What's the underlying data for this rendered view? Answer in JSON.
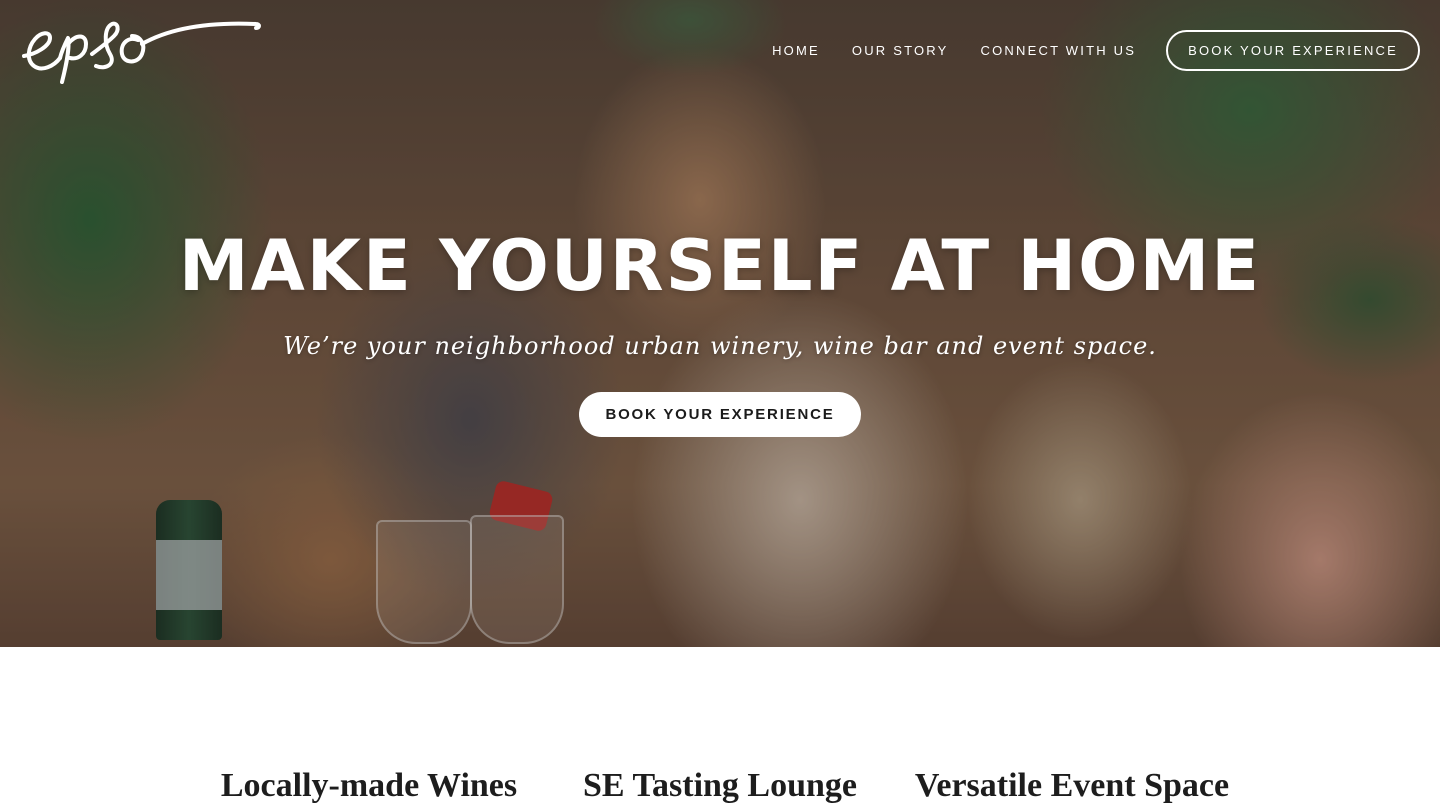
{
  "brand": {
    "logo_text": "enso"
  },
  "nav": {
    "items": [
      {
        "label": "HOME"
      },
      {
        "label": "OUR STORY"
      },
      {
        "label": "CONNECT WITH US"
      }
    ],
    "cta_label": "BOOK YOUR EXPERIENCE"
  },
  "hero": {
    "title": "MAKE YOURSELF AT HOME",
    "subtitle": "We’re your neighborhood urban winery, wine bar and event space.",
    "button_label": "BOOK YOUR EXPERIENCE"
  },
  "features": [
    {
      "title": "Locally-made Wines"
    },
    {
      "title": "SE Tasting Lounge"
    },
    {
      "title": "Versatile Event Space"
    }
  ],
  "colors": {
    "text_on_hero": "#ffffff",
    "button_bg": "#ffffff",
    "button_text": "#1b1b1b",
    "feature_text": "#1d1d1d"
  }
}
